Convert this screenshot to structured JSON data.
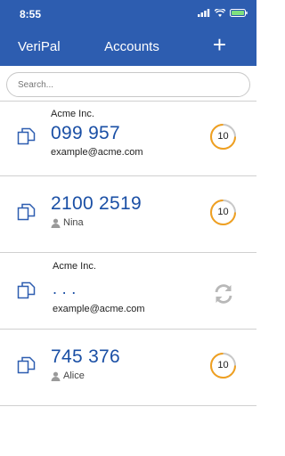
{
  "status": {
    "time": "8:55"
  },
  "nav": {
    "left": "VeriPal",
    "title": "Accounts",
    "add": "+"
  },
  "search": {
    "placeholder": "Search..."
  },
  "accounts": [
    {
      "issuer": "Acme Inc.",
      "code": "099 957",
      "account": "example@acme.com",
      "timer": "10"
    },
    {
      "issuer": "",
      "code": "2100 2519",
      "user": "Nina",
      "timer": "10"
    },
    {
      "issuer": "Acme Inc.",
      "code": ". . .",
      "account": "example@acme.com"
    },
    {
      "issuer": "",
      "code": "745 376",
      "user": "Alice",
      "timer": "10"
    }
  ],
  "colors": {
    "header": "#2d5db0",
    "code": "#1a4fa5",
    "timer_ring": "#f0a020"
  }
}
